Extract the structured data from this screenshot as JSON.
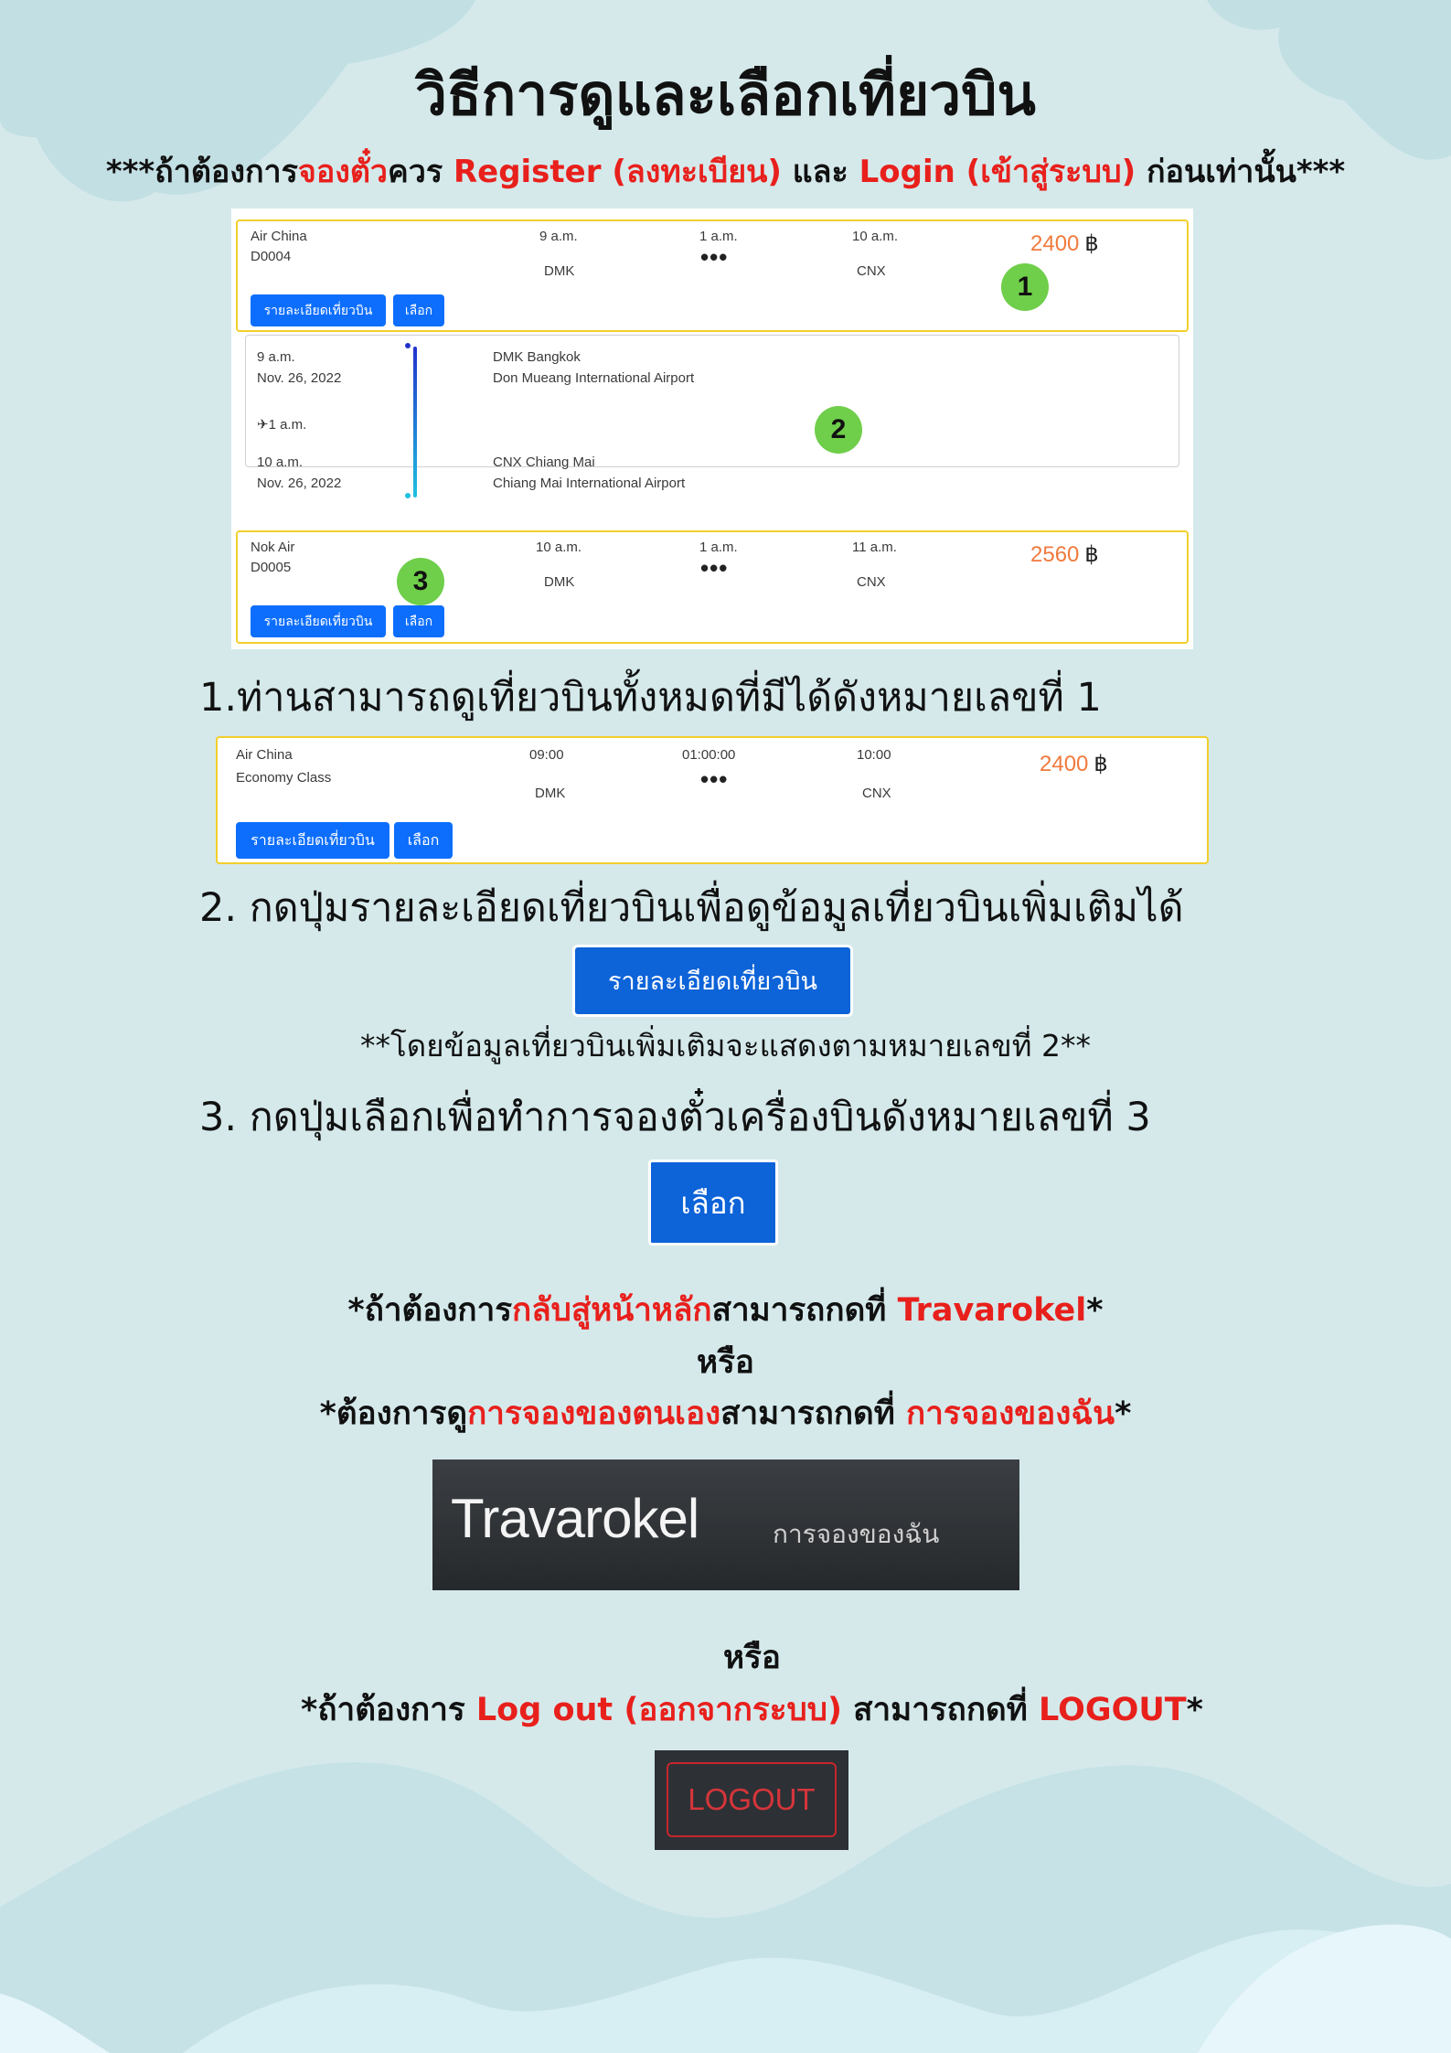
{
  "title": "วิธีการดูและเลือกเที่ยวบิน",
  "subtitle": {
    "p1": "***ถ้าต้องการ",
    "p2": "จองตั๋ว",
    "p3": "ควร ",
    "p4": "Register (ลงทะเบียน)",
    "p5": " และ ",
    "p6": "Login (เข้าสู่ระบบ)",
    "p7": " ก่อนเท่านั้น***"
  },
  "flights": [
    {
      "airline": "Air China",
      "code": "D0004",
      "depart_time": "9 a.m.",
      "duration": "1 a.m.",
      "arrive_time": "10 a.m.",
      "from": "DMK",
      "to": "CNX",
      "price": "2400",
      "currency": "฿",
      "details_label": "รายละเอียดเที่ยวบิน",
      "select_label": "เลือก",
      "badge": "1"
    },
    {
      "airline": "Nok Air",
      "code": "D0005",
      "depart_time": "10 a.m.",
      "duration": "1 a.m.",
      "arrive_time": "11 a.m.",
      "from": "DMK",
      "to": "CNX",
      "price": "2560",
      "currency": "฿",
      "details_label": "รายละเอียดเที่ยวบิน",
      "select_label": "เลือก",
      "badge": "3"
    }
  ],
  "detail": {
    "dep_time": "9 a.m.",
    "dep_date": "Nov. 26, 2022",
    "dep_airport": "DMK Bangkok",
    "dep_airport_full": "Don Mueang International Airport",
    "duration": "1 a.m.",
    "arr_time": "10 a.m.",
    "arr_date": "Nov. 26, 2022",
    "arr_airport": "CNX Chiang Mai",
    "arr_airport_full": "Chiang Mai International Airport",
    "badge": "2"
  },
  "step1": "1.ท่านสามารถดูเที่ยวบินทั้งหมดที่มีได้ดังหมายเลขที่ 1",
  "flight2": {
    "airline": "Air China",
    "class": "Economy Class",
    "depart_time": "09:00",
    "duration": "01:00:00",
    "arrive_time": "10:00",
    "from": "DMK",
    "to": "CNX",
    "price": "2400",
    "currency": "฿",
    "details_label": "รายละเอียดเที่ยวบิน",
    "select_label": "เลือก"
  },
  "step2": "2. กดปุ่มรายละเอียดเที่ยวบินเพื่อดูข้อมูลเที่ยวบินเพิ่มเติมได้",
  "details_button": "รายละเอียดเที่ยวบิน",
  "note": "**โดยข้อมูลเที่ยวบินเพิ่มเติมจะแสดงตามหมายเลขที่ 2**",
  "step3": "3. กดปุ่มเลือกเพื่อทำการจองตั๋วเครื่องบินดังหมายเลขที่ 3",
  "select_button": "เลือก",
  "home_line": {
    "p1": "*ถ้าต้องการ",
    "p2": "กลับสู่หน้าหลัก",
    "p3": "สามารถกดที่ ",
    "p4": "Travarokel",
    "p5": "*"
  },
  "or1": "หรือ",
  "booking_line": {
    "p1": "*ต้องการดู",
    "p2": "การจองของตนเอง",
    "p3": "สามารถกดที่ ",
    "p4": "การจองของฉัน",
    "p5": "*"
  },
  "navbar": {
    "brand": "Travarokel",
    "link": "การจองของฉัน"
  },
  "or2": "หรือ",
  "logout_line": {
    "p1": "*ถ้าต้องการ ",
    "p2": "Log out (ออกจากระบบ)",
    "p3": " สามารถกดที่ ",
    "p4": "LOGOUT",
    "p5": "*"
  },
  "logout_button": "LOGOUT",
  "colors": {
    "background": "#d5e9eb",
    "accent_red": "#e8201c",
    "button_blue": "#0d6efd",
    "price_orange": "#f07a3c",
    "card_border": "#f2cf2c",
    "badge_green": "#6fce4a"
  }
}
